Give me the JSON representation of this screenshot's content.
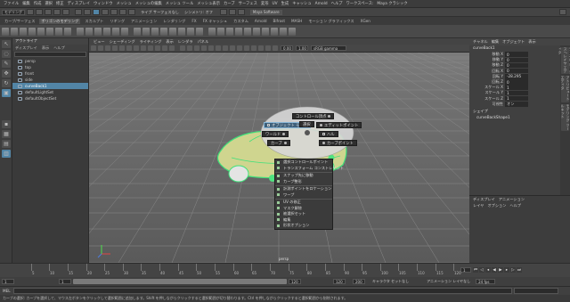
{
  "menubar": {
    "items": [
      "ファイル",
      "編集",
      "作成",
      "選択",
      "修正",
      "ディスプレイ",
      "ウィンドウ",
      "メッシュ",
      "メッシュの編集",
      "メッシュ ツール",
      "メッシュ表示",
      "カーブ",
      "サーフェス",
      "変形",
      "UV",
      "生成",
      "キャッシュ",
      "Arnold",
      "ヘルプ"
    ],
    "workspace_label": "ワークスペース:",
    "workspace_value": "Maya クラシック"
  },
  "status": {
    "mode": "モデリング",
    "live_surface": "ライブ サーフェスなし",
    "symmetry": "シンメトリ: オフ",
    "renderer": "Maya Software"
  },
  "shelf_tabs": [
    "カーブ/サーフェス",
    "ポリゴンのモデリング",
    "スカルプト",
    "リギング",
    "アニメーション",
    "レンダリング",
    "FX",
    "FX キャッシュ",
    "カスタム",
    "Arnold",
    "Bifrost",
    "MASH",
    "モーション グラフィックス",
    "XGen"
  ],
  "outliner": {
    "title": "アウトライナ",
    "menu": [
      "ディスプレイ",
      "表示",
      "ヘルプ"
    ],
    "items": [
      {
        "label": "persp",
        "selected": false
      },
      {
        "label": "top",
        "selected": false
      },
      {
        "label": "front",
        "selected": false
      },
      {
        "label": "side",
        "selected": false
      },
      {
        "label": "curveBack1",
        "selected": true
      },
      {
        "label": "defaultLightSet",
        "selected": false
      },
      {
        "label": "defaultObjectSet",
        "selected": false
      }
    ]
  },
  "viewport": {
    "menu": [
      "ビュー",
      "シェーディング",
      "ライティング",
      "表示",
      "レンダラ",
      "パネル"
    ],
    "field_a": "0.00",
    "field_b": "1.00",
    "colorspace": "sRGB gamma",
    "camera_label": "persp"
  },
  "radial_menu": {
    "items": [
      "コントロール頂点",
      "エディットポイント",
      "ハル",
      "カーブポイント",
      "オブジェクト モード",
      "カーブ",
      "ワールド",
      "選択"
    ]
  },
  "context_menu": {
    "items": [
      "選択コントロールポイント",
      "トランスフォーム コンストレイント",
      "スナップ先に移動",
      "カーブ整形",
      "計測ポイントをロケーション",
      "ワープ",
      "UV の修正",
      "マスク解除",
      "被選択セット",
      "編集",
      "形状オプション"
    ]
  },
  "channel_box": {
    "tabs": [
      "チャネル",
      "編集",
      "オブジェクト",
      "表示"
    ],
    "node_name": "curveBack1",
    "attrs": [
      {
        "label": "移動 X",
        "value": "0"
      },
      {
        "label": "移動 Y",
        "value": "0"
      },
      {
        "label": "移動 Z",
        "value": "0"
      },
      {
        "label": "回転 X",
        "value": "0"
      },
      {
        "label": "回転 Y",
        "value": "-28.295"
      },
      {
        "label": "回転 Z",
        "value": "0"
      },
      {
        "label": "スケール X",
        "value": "1"
      },
      {
        "label": "スケール Y",
        "value": "1"
      },
      {
        "label": "スケール Z",
        "value": "1"
      },
      {
        "label": "可視性",
        "value": "オン"
      }
    ],
    "shapes_title": "シェイプ",
    "shape_name": "curveBackShape1",
    "side_tabs": [
      "チャネル ボックス / レイヤ エディタ",
      "アトリビュート エディタ",
      "モデリング ツールキット"
    ]
  },
  "layers": {
    "tabs": [
      "ディスプレイ",
      "アニメーション"
    ],
    "menu": [
      "レイヤ",
      "オプション",
      "ヘルプ"
    ]
  },
  "timeslider": {
    "ticks": [
      "5",
      "10",
      "15",
      "20",
      "25",
      "30",
      "35",
      "40",
      "45",
      "50",
      "55",
      "60",
      "65",
      "70",
      "75",
      "80",
      "85",
      "90",
      "95",
      "100",
      "105",
      "110",
      "115",
      "120"
    ],
    "current_frame": "1"
  },
  "range": {
    "start": "1",
    "start_inner": "1",
    "end_inner": "120",
    "end": "120",
    "end_outer": "200",
    "character_set": "キャラクタ セットなし",
    "anim_layer": "アニメーション レイヤなし",
    "fps": "24 fps"
  },
  "cmdline": {
    "label": "MEL"
  },
  "help_line": "カーブの選択: カーブを選択して、マウス左ボタンをクリックして選択範囲に追加します。Shift を押しながらクリックすると選択範囲が切り替わります。Ctrl を押しながらクリックすると選択範囲から削除されます。"
}
